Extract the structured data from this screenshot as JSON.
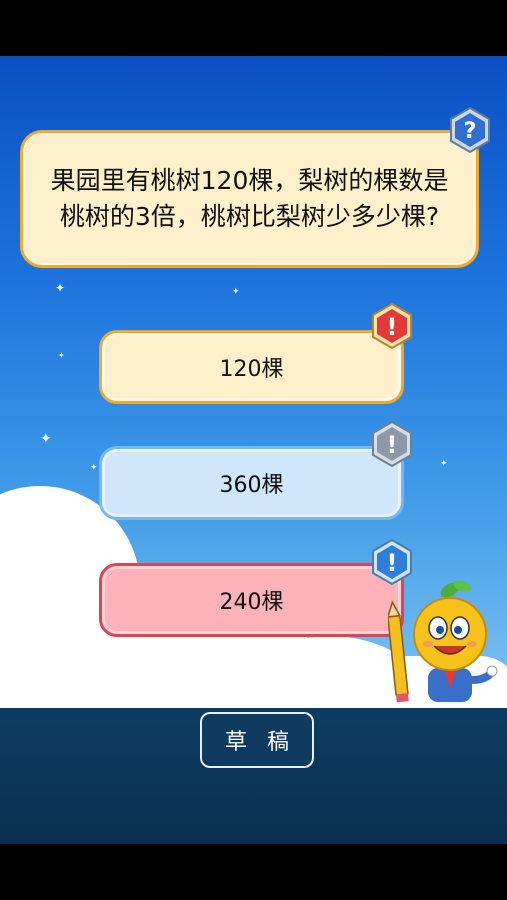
{
  "question": {
    "text": "果园里有桃树120棵，梨树的棵数是桃树的3倍，桃树比梨树少多少棵?",
    "badge_icon": "question-mark-icon"
  },
  "answers": [
    {
      "label": "120棵",
      "state": "default",
      "color": "#fff0cc"
    },
    {
      "label": "360棵",
      "state": "default",
      "color": "#cfe6fb"
    },
    {
      "label": "240棵",
      "state": "selected",
      "color": "#ffb3b9"
    }
  ],
  "answer_badge_icon": "exclamation-icon",
  "draft_button": {
    "label": "草稿"
  },
  "colors": {
    "sky_top": "#0b4fc4",
    "bottom_bar": "#0b2f50",
    "card_border": "#f2a92b"
  }
}
